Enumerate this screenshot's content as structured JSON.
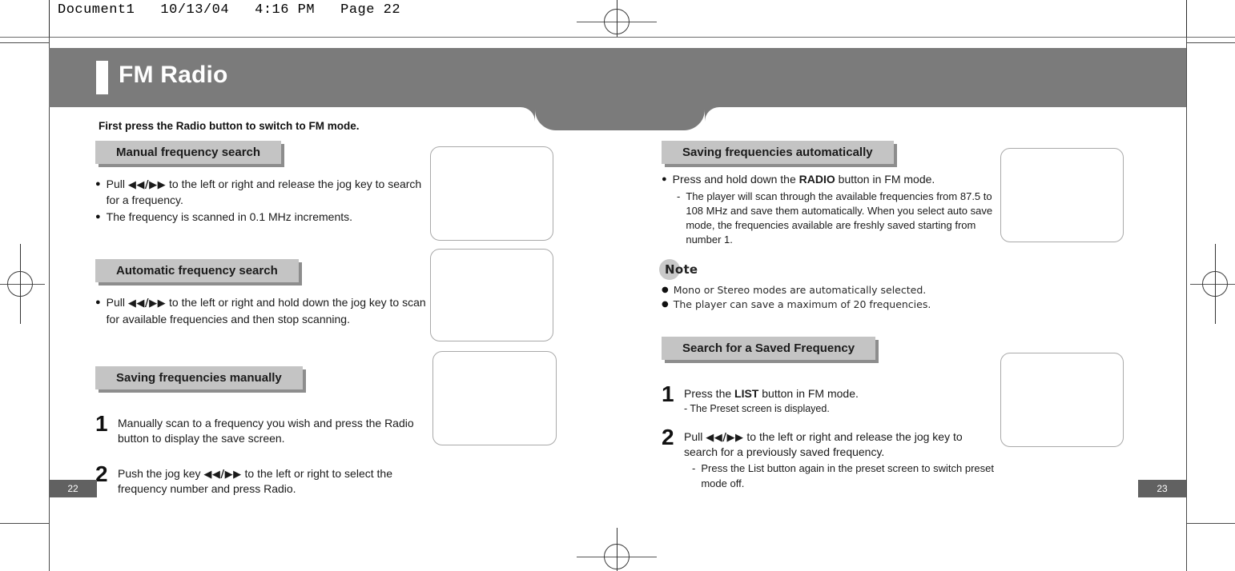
{
  "scan": {
    "header_text": "Document1   10/13/04   4:16 PM   Page 22"
  },
  "banner": {
    "title": "FM Radio"
  },
  "intro": "First press the Radio button to switch to FM mode.",
  "left_column": {
    "sections": [
      {
        "heading": "Manual frequency search",
        "bullets": [
          {
            "pre": "Pull ",
            "jog": "◀◀/▶▶",
            "post": " to the left or right and release the jog key to search for a frequency."
          },
          {
            "pre": "The frequency is scanned in 0.1 MHz increments.",
            "jog": "",
            "post": ""
          }
        ]
      },
      {
        "heading": "Automatic frequency search",
        "bullets": [
          {
            "pre": "Pull ",
            "jog": "◀◀/▶▶",
            "post": " to the left or right and hold down the jog key to scan for available frequencies and then stop scanning."
          }
        ]
      },
      {
        "heading": "Saving frequencies manually",
        "steps": [
          {
            "number": "1",
            "pre": "Manually scan to a frequency you wish and press the Radio button to display the save screen.",
            "jog": "",
            "post": ""
          },
          {
            "number": "2",
            "pre": "Push the jog key ",
            "jog": "◀◀/▶▶",
            "post": " to the left or right to select the frequency number and press Radio."
          }
        ]
      }
    ]
  },
  "right_column": {
    "sections": [
      {
        "heading": "Saving frequencies automatically",
        "bullet_pre": "Press and hold down the ",
        "bullet_bold": "RADIO",
        "bullet_post": " button in FM mode.",
        "sub": "The player will scan through the available frequencies from 87.5 to 108 MHz and save them automatically. When you select auto save mode, the frequencies available are freshly saved starting from number 1."
      },
      {
        "heading": "Search for a Saved Frequency",
        "steps": [
          {
            "number": "1",
            "pre": "Press the ",
            "bold": "LIST",
            "post": " button in FM mode.",
            "sub": "The Preset screen is displayed."
          },
          {
            "number": "2",
            "pre": "Pull ",
            "jog": "◀◀/▶▶",
            "post": " to the left or right and release the jog key to search for a previously saved frequency.",
            "sub": "Press the List button again in the preset screen to switch preset mode off."
          }
        ]
      }
    ],
    "note": {
      "label": "Note",
      "items": [
        "Mono or Stereo modes are automatically selected.",
        "The player can save a maximum of 20 frequencies."
      ]
    }
  },
  "footer": {
    "left_page": "22",
    "right_page": "23"
  },
  "glyphs": {
    "bullet": "●",
    "dash": "-"
  }
}
